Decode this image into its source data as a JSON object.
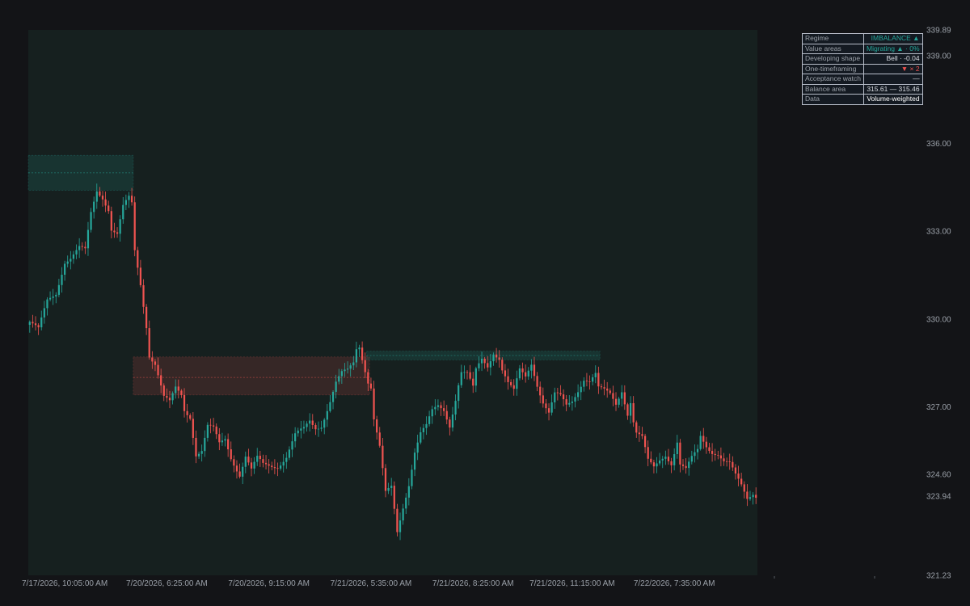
{
  "chart_data": {
    "type": "candlestick",
    "title": "",
    "xlabel": "",
    "ylabel": "",
    "ylim": [
      321.23,
      339.89
    ],
    "y_ticks": [
      "339.89",
      "339.00",
      "336.00",
      "333.00",
      "330.00",
      "327.00",
      "324.60",
      "323.94",
      "321.23"
    ],
    "x_ticks": [
      {
        "index": 12,
        "label": "7/17/2026, 10:05:00 AM"
      },
      {
        "index": 47,
        "label": "7/20/2026, 6:25:00 AM"
      },
      {
        "index": 82,
        "label": "7/20/2026, 9:15:00 AM"
      },
      {
        "index": 117,
        "label": "7/21/2026, 5:35:00 AM"
      },
      {
        "index": 152,
        "label": "7/21/2026, 8:25:00 AM"
      },
      {
        "index": 186,
        "label": "7/21/2026, 11:15:00 AM"
      },
      {
        "index": 221,
        "label": "7/22/2026, 7:35:00 AM"
      }
    ],
    "bar_count": 250,
    "series": [
      {
        "name": "",
        "anchors": [
          [
            0,
            329.9
          ],
          [
            3,
            329.6
          ],
          [
            6,
            330.6
          ],
          [
            9,
            330.9
          ],
          [
            12,
            332.0
          ],
          [
            14,
            332.1
          ],
          [
            17,
            332.4
          ],
          [
            19,
            332.3
          ],
          [
            21,
            333.6
          ],
          [
            23,
            334.4
          ],
          [
            25,
            334.2
          ],
          [
            27,
            333.8
          ],
          [
            28,
            333.1
          ],
          [
            30,
            332.9
          ],
          [
            32,
            333.8
          ],
          [
            34,
            334.1
          ],
          [
            35,
            333.9
          ],
          [
            36,
            332.3
          ],
          [
            38,
            331.2
          ],
          [
            40,
            329.8
          ],
          [
            41,
            328.8
          ],
          [
            43,
            328.5
          ],
          [
            45,
            327.7
          ],
          [
            46,
            327.3
          ],
          [
            48,
            327.1
          ],
          [
            50,
            327.6
          ],
          [
            52,
            327.4
          ],
          [
            53,
            326.9
          ],
          [
            55,
            326.7
          ],
          [
            57,
            325.4
          ],
          [
            59,
            325.5
          ],
          [
            61,
            326.3
          ],
          [
            63,
            326.2
          ],
          [
            65,
            325.7
          ],
          [
            67,
            325.9
          ],
          [
            69,
            325.3
          ],
          [
            71,
            324.9
          ],
          [
            72,
            324.7
          ],
          [
            74,
            325.3
          ],
          [
            76,
            324.8
          ],
          [
            78,
            325.2
          ],
          [
            80,
            325.0
          ],
          [
            83,
            325.0
          ],
          [
            85,
            325.0
          ],
          [
            88,
            325.3
          ],
          [
            91,
            326.0
          ],
          [
            94,
            326.2
          ],
          [
            96,
            326.5
          ],
          [
            98,
            326.3
          ],
          [
            100,
            326.4
          ],
          [
            103,
            327.2
          ],
          [
            105,
            327.8
          ],
          [
            107,
            328.1
          ],
          [
            109,
            328.2
          ],
          [
            111,
            328.5
          ],
          [
            112,
            329.0
          ],
          [
            113,
            329.1
          ],
          [
            114,
            328.7
          ],
          [
            116,
            327.9
          ],
          [
            117,
            327.7
          ],
          [
            118,
            326.6
          ],
          [
            120,
            325.6
          ],
          [
            122,
            324.0
          ],
          [
            124,
            324.2
          ],
          [
            126,
            322.7
          ],
          [
            128,
            323.6
          ],
          [
            130,
            324.4
          ],
          [
            132,
            325.5
          ],
          [
            134,
            326.1
          ],
          [
            136,
            326.3
          ],
          [
            138,
            326.8
          ],
          [
            140,
            327.0
          ],
          [
            142,
            326.9
          ],
          [
            144,
            326.4
          ],
          [
            146,
            327.3
          ],
          [
            147,
            327.8
          ],
          [
            148,
            328.2
          ],
          [
            150,
            328.1
          ],
          [
            152,
            327.6
          ],
          [
            153,
            328.2
          ],
          [
            155,
            328.6
          ],
          [
            157,
            328.4
          ],
          [
            159,
            328.9
          ],
          [
            161,
            328.7
          ],
          [
            162,
            328.3
          ],
          [
            164,
            327.8
          ],
          [
            166,
            327.5
          ],
          [
            168,
            328.2
          ],
          [
            170,
            328.0
          ],
          [
            172,
            328.5
          ],
          [
            174,
            327.8
          ],
          [
            176,
            327.2
          ],
          [
            178,
            326.8
          ],
          [
            180,
            327.4
          ],
          [
            182,
            327.3
          ],
          [
            184,
            327.0
          ],
          [
            186,
            327.2
          ],
          [
            188,
            327.6
          ],
          [
            190,
            328.0
          ],
          [
            192,
            327.9
          ],
          [
            194,
            328.1
          ],
          [
            195,
            327.6
          ],
          [
            197,
            327.5
          ],
          [
            199,
            327.4
          ],
          [
            201,
            327.1
          ],
          [
            203,
            327.6
          ],
          [
            205,
            326.8
          ],
          [
            206,
            327.2
          ],
          [
            207,
            326.5
          ],
          [
            208,
            326.1
          ],
          [
            210,
            325.9
          ],
          [
            212,
            325.1
          ],
          [
            214,
            324.9
          ],
          [
            216,
            325.2
          ],
          [
            218,
            325.4
          ],
          [
            220,
            325.1
          ],
          [
            222,
            325.8
          ],
          [
            223,
            325.0
          ],
          [
            225,
            324.8
          ],
          [
            227,
            325.2
          ],
          [
            229,
            325.5
          ],
          [
            230,
            326.0
          ],
          [
            232,
            325.7
          ],
          [
            234,
            325.5
          ],
          [
            236,
            325.4
          ],
          [
            238,
            325.1
          ],
          [
            240,
            325.0
          ],
          [
            242,
            324.6
          ],
          [
            244,
            324.3
          ],
          [
            246,
            323.9
          ],
          [
            248,
            324.1
          ],
          [
            249,
            324.0
          ]
        ]
      }
    ],
    "zones": [
      {
        "index_from": 0,
        "index_to": 35,
        "y_high": 335.6,
        "y_low": 334.4,
        "y_mid": 335.0,
        "color": "#26a69a"
      },
      {
        "index_from": 36,
        "index_to": 116,
        "y_high": 328.7,
        "y_low": 327.4,
        "y_mid": 328.0,
        "color": "#ef5350"
      },
      {
        "index_from": 116,
        "index_to": 195,
        "y_high": 328.9,
        "y_low": 328.6,
        "y_mid": 328.75,
        "color": "#26a69a"
      }
    ],
    "last_price_labels": [
      "324.60",
      "323.94"
    ],
    "colors": {
      "up": "#26a69a",
      "down": "#ef5350",
      "plot_bg": "#16201f",
      "page_bg": "#131417"
    }
  },
  "status_table": {
    "rows": [
      {
        "key": "Regime",
        "value": "IMBALANCE ▲",
        "color": "#26a69a"
      },
      {
        "key": "Value areas",
        "value": "Migrating ▲ · 0%",
        "color": "#26a69a"
      },
      {
        "key": "Developing shape",
        "value": "Bell · -0.04",
        "color": "#d8dce2"
      },
      {
        "key": "One-timeframing",
        "value": "▼ × 2",
        "color": "#ef5350"
      },
      {
        "key": "Acceptance watch",
        "value": "—",
        "color": "#d8dce2"
      },
      {
        "key": "Balance area",
        "value": "315.61 — 315.46",
        "color": "#d8dce2"
      },
      {
        "key": "Data",
        "value": "Volume-weighted",
        "color": "#ffffff"
      }
    ]
  }
}
